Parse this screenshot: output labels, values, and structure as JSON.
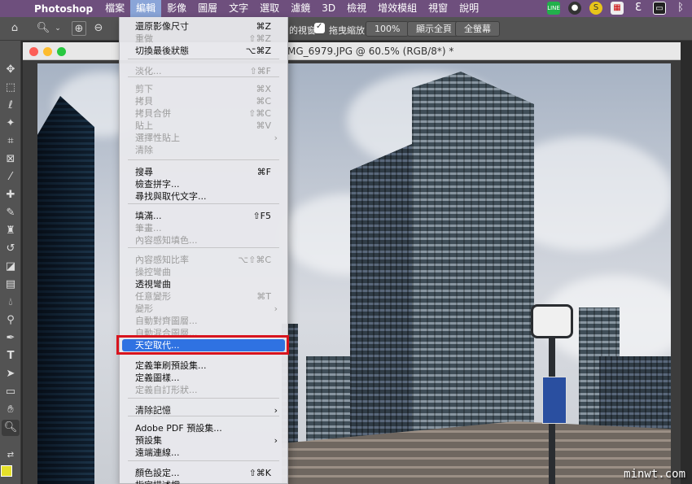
{
  "menubar": {
    "apple": "",
    "app": "Photoshop",
    "menus": [
      "檔案",
      "編輯",
      "影像",
      "圖層",
      "文字",
      "選取",
      "濾鏡",
      "3D",
      "檢視",
      "增效模組",
      "視窗",
      "說明"
    ],
    "status_icons": [
      "line-icon",
      "circle-icon",
      "s-icon",
      "clapper-icon",
      "e-icon",
      "display-icon",
      "bluetooth-icon"
    ]
  },
  "options_bar": {
    "labels": [
      "的視窗",
      "拖曳縮放"
    ],
    "buttons": [
      "100%",
      "顯示全頁",
      "全螢幕"
    ]
  },
  "document": {
    "title": "MG_6979.JPG @ 60.5% (RGB/8*) *"
  },
  "edit_menu": {
    "items": [
      {
        "label": "還原影像尺寸",
        "shortcut": "⌘Z",
        "disabled": false
      },
      {
        "label": "重做",
        "shortcut": "⇧⌘Z",
        "disabled": true
      },
      {
        "label": "切換最後狀態",
        "shortcut": "⌥⌘Z",
        "disabled": false
      },
      {
        "label": "淡化...",
        "shortcut": "⇧⌘F",
        "disabled": true
      },
      {
        "label": "剪下",
        "shortcut": "⌘X",
        "disabled": true
      },
      {
        "label": "拷貝",
        "shortcut": "⌘C",
        "disabled": true
      },
      {
        "label": "拷貝合併",
        "shortcut": "⇧⌘C",
        "disabled": true
      },
      {
        "label": "貼上",
        "shortcut": "⌘V",
        "disabled": true
      },
      {
        "label": "選擇性貼上",
        "shortcut": "",
        "disabled": true,
        "submenu": true
      },
      {
        "label": "清除",
        "shortcut": "",
        "disabled": true
      },
      {
        "label": "搜尋",
        "shortcut": "⌘F",
        "disabled": false
      },
      {
        "label": "檢查拼字...",
        "shortcut": "",
        "disabled": false
      },
      {
        "label": "尋找與取代文字...",
        "shortcut": "",
        "disabled": false
      },
      {
        "label": "填滿...",
        "shortcut": "⇧F5",
        "disabled": false
      },
      {
        "label": "筆畫...",
        "shortcut": "",
        "disabled": true
      },
      {
        "label": "內容感知填色...",
        "shortcut": "",
        "disabled": true
      },
      {
        "label": "內容感知比率",
        "shortcut": "⌥⇧⌘C",
        "disabled": true
      },
      {
        "label": "操控彎曲",
        "shortcut": "",
        "disabled": true
      },
      {
        "label": "透視彎曲",
        "shortcut": "",
        "disabled": false
      },
      {
        "label": "任意變形",
        "shortcut": "⌘T",
        "disabled": true
      },
      {
        "label": "變形",
        "shortcut": "",
        "disabled": true,
        "submenu": true
      },
      {
        "label": "自動對齊圖層...",
        "shortcut": "",
        "disabled": true
      },
      {
        "label": "自動混合圖層...",
        "shortcut": "",
        "disabled": true
      },
      {
        "label": "天空取代...",
        "shortcut": "",
        "disabled": false,
        "highlighted": true
      },
      {
        "label": "定義筆刷預設集...",
        "shortcut": "",
        "disabled": false
      },
      {
        "label": "定義圖樣...",
        "shortcut": "",
        "disabled": false
      },
      {
        "label": "定義自訂形狀...",
        "shortcut": "",
        "disabled": true
      },
      {
        "label": "清除記憶",
        "shortcut": "",
        "disabled": false,
        "submenu": true
      },
      {
        "label": "Adobe PDF 預設集...",
        "shortcut": "",
        "disabled": false
      },
      {
        "label": "預設集",
        "shortcut": "",
        "disabled": false,
        "submenu": true
      },
      {
        "label": "遠端連線...",
        "shortcut": "",
        "disabled": false
      },
      {
        "label": "顏色設定...",
        "shortcut": "⇧⌘K",
        "disabled": false
      },
      {
        "label": "指定描述檔...",
        "shortcut": "",
        "disabled": false
      }
    ]
  },
  "watermark": "minwt.com",
  "colors": {
    "menubar": "#6e4f7d",
    "highlight": "#2f72e2",
    "callout": "#d8141e",
    "foreground_swatch": "#e5e02a"
  }
}
